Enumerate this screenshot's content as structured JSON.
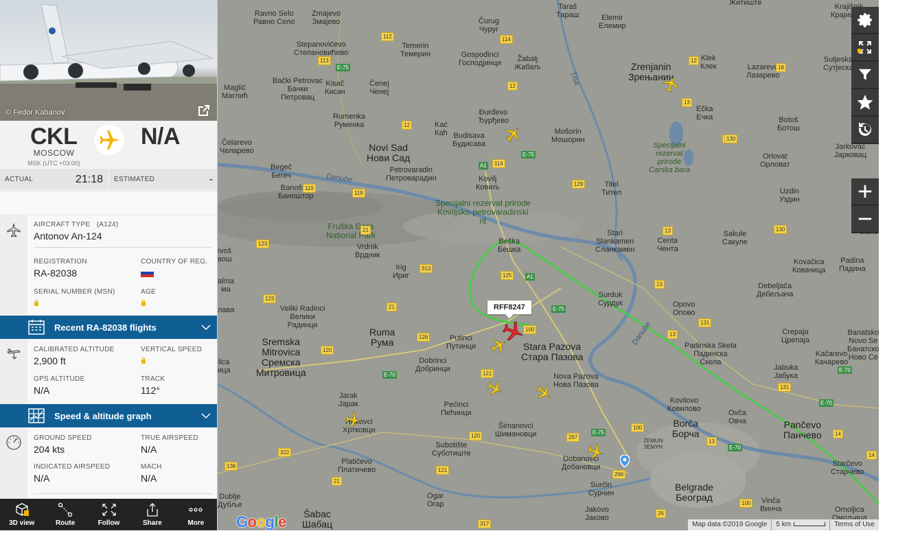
{
  "photo": {
    "credit": "© Fedor Kabanov"
  },
  "route": {
    "origin_code": "CKL",
    "origin_city": "MOSCOW",
    "origin_tz": "MSK (UTC +03:00)",
    "destination_code": "N/A"
  },
  "times": {
    "actual_label": "ACTUAL",
    "actual_value": "21:18",
    "estimated_label": "ESTIMATED",
    "estimated_value": "-"
  },
  "aircraft": {
    "type_label": "AIRCRAFT TYPE",
    "type_code": "(A124)",
    "type_value": "Antonov An-124",
    "registration_label": "REGISTRATION",
    "registration_value": "RA-82038",
    "country_label": "COUNTRY OF REG.",
    "serial_label": "SERIAL NUMBER (MSN)",
    "age_label": "AGE"
  },
  "recent_flights": {
    "label": "Recent RA-82038 flights"
  },
  "altitude": {
    "calibrated_label": "CALIBRATED ALTITUDE",
    "calibrated_value": "2,900 ft",
    "vertical_label": "VERTICAL SPEED",
    "gps_label": "GPS ALTITUDE",
    "gps_value": "N/A",
    "track_label": "TRACK",
    "track_value": "112°"
  },
  "graph": {
    "label": "Speed & altitude graph"
  },
  "speed": {
    "ground_label": "GROUND SPEED",
    "ground_value": "204 kts",
    "true_label": "TRUE AIRSPEED",
    "true_value": "N/A",
    "indicated_label": "INDICATED AIRSPEED",
    "indicated_value": "N/A",
    "mach_label": "MACH",
    "mach_value": "N/A"
  },
  "bottom_bar": {
    "view3d": "3D view",
    "route": "Route",
    "follow": "Follow",
    "share": "Share",
    "more": "More"
  },
  "map": {
    "callsign": "RFF8247",
    "footer_data": "Map data ©2019 Google",
    "footer_scale": "5 km",
    "footer_terms": "Terms of Use",
    "logo": "Google",
    "places": {
      "ravno_selo": "Ravno Selo\nРавно Село",
      "zmajevo": "Zmajevo\nЗмајево",
      "curug": "Čurug\nЧуруг",
      "taras": "Taraš\nТараш",
      "elemir": "Elemir\nЕлемир",
      "zitiste": "Житиште",
      "krajisnik": "Krajišnik\nКрајишник",
      "stepanovicevo": "Stepanovićevo\nСтепановићево",
      "temerin": "Temerin\nТемерин",
      "gospodjinci": "Gospođinci\nГосподјинци",
      "zabalj": "Žabalj\nЖабаљ",
      "zrenjanin": "Zrenjanin\nЗрењанин",
      "klek": "Klek\nКлек",
      "lazarevo": "Lazarevo\nЛазарево",
      "sutjeska": "Sutjeska\nСутјеска",
      "magl": "Maglić\nМаглић",
      "backi_petrovac": "Bački Petrovac\nБачки\nПетровац",
      "kisac": "Kisač\nКисач",
      "cenej": "Čenej\nЧенеј",
      "durdevo": "Đurđevo\nЂурђево",
      "ecka": "Ečka\nЕчка",
      "botos": "Botoš\nБотош",
      "rumenka": "Rumenka\nРуменка",
      "kac": "Kać\nКаћ",
      "budisava": "Budisava\nБудисава",
      "mosorin": "Mošorin\nМошорин",
      "celarevo": "Čelarevo\nЧеларево",
      "novi_sad": "Novi Sad\nНови Сад",
      "specijalni_carska": "Specijalni\nrezervat\nprirode\nCarska bara",
      "orlovat": "Orlovat\nОрловат",
      "jarkovac": "Jarkovac\nЈарковац",
      "begec": "Begeč\nБегеч",
      "petrovaradin": "Petrovaradin\nПетроварадин",
      "kovilj": "Kovilj\nКовиљ",
      "titel": "Titel\nТител",
      "uzdin": "Uzdin\nУздин",
      "banostor": "Banoštor\nБаноштор",
      "specijalni_kovilj": "Specijalni rezervat prirode\nKoviljsko-petrovaradinski\nrit",
      "fruska_gora": "Fruška Gora\nNational Park",
      "vrdnik": "Vrdnik\nВрдник",
      "besk": "Beška\nБешка",
      "stari_slankamen": "Stari\nSlankamen\nСланкамен",
      "centa": "Centa\nЧента",
      "sakule": "Sakule\nСакуле",
      "samos": "Samoš\nСамош",
      "kovacica": "Kovačica\nКовачица",
      "padina": "Padina\nПадина",
      "irig": "Irig\nИриг",
      "vrsac_left": "Vrdnik",
      "surduk": "Surduk\nСурдук",
      "debeljaca": "Debeljača\nДебељача",
      "opovo": "Opovo\nОпово",
      "veliki_radinci": "Veliki Radinci\nВелики\nРадинци",
      "ruma": "Ruma\nРума",
      "putinci": "Putinci\nПутинци",
      "stara_pazova": "Stara Pazova\nСтара Пазова",
      "crepaja": "Crepaja\nЦрепаја",
      "banatsko": "Banatsko\nNovo Se\nБанатско\nНово Се",
      "sremska_mitrovica": "Sremska\nMitrovica\nСремска\nМитровица",
      "dobrinci": "Dobrinci\nДобринци",
      "nova_pazova": "Nova Pazova\nНова Пазова",
      "padinska_skela": "Padinska Skela\nПадинска\nСкела",
      "jabuka": "Jabuka\nЈабука",
      "kacarevo": "Kačarevo\nКачарево",
      "jarak": "Jarak\nЈарак",
      "pecinci": "Pećinci\nПећинци",
      "kovilovo": "Kovilovo\nКовилово",
      "ovca": "Ovča\nОвча",
      "hrtkovci": "Hrtkovci\nХртковци",
      "simanovci": "Šimanovci\nШимановци",
      "borca": "Borča\nБорча",
      "pancevo": "Pančevo\nПанчево",
      "subotiste": "Subotište\nСуботиште",
      "dobanovci": "Dobanovci\nДобановци",
      "zemun": "ZEMUN\nЗЕМУН",
      "platicevo": "Platičevo\nПлатичево",
      "starcevo": "Starčevo\nСтарчево",
      "belgrade": "Belgrade\nБеоград",
      "dublje": "Dublje\nДубље",
      "ogar": "Ogar\nОгар",
      "surcin": "Surčin\nСурчин",
      "vinca": "Vinča\nВинча",
      "sabac": "Šabac\nШабац",
      "jakovo": "Jakovo\nЈаково",
      "omoljica": "Omoljica\nОмољица",
      "danube_left": "Danube",
      "danube_right": "Danube",
      "tisa": "Tisa",
      "ivos": "ivoš\nвош",
      "alma": "alma\nма",
      "lava": "лава",
      "kaica": "lica\nица"
    },
    "roads": [
      "112",
      "113",
      "E-75",
      "12",
      "114",
      "12",
      "12",
      "13",
      "18",
      "13",
      "130",
      "129",
      "119",
      "119",
      "A1",
      "114",
      "E-75",
      "21",
      "123",
      "313",
      "125",
      "A1",
      "129",
      "13",
      "13",
      "E-75",
      "130",
      "131",
      "123",
      "21",
      "100",
      "126",
      "120",
      "E-70",
      "121",
      "13",
      "E-70",
      "131",
      "E-70",
      "322",
      "120",
      "267",
      "E-75",
      "100",
      "14",
      "136",
      "121",
      "13",
      "E-70",
      "14",
      "266",
      "21",
      "26",
      "100",
      "317"
    ]
  }
}
